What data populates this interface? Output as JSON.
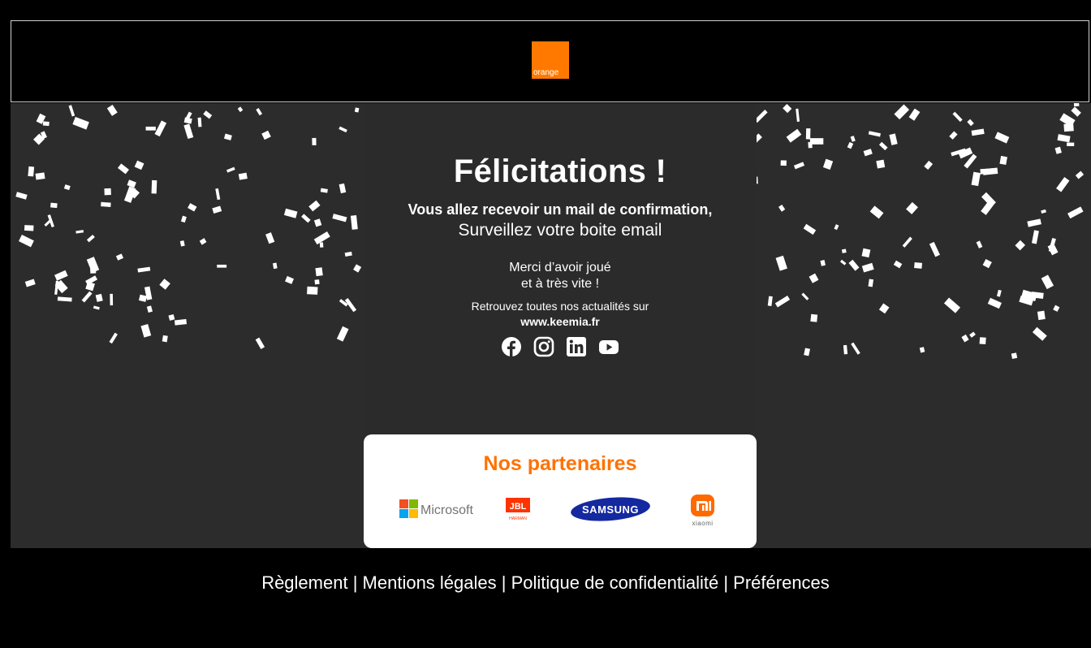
{
  "brand": {
    "logo_text": "orange",
    "color": "#ff7900"
  },
  "congrats": {
    "title": "Félicitations !",
    "mail_line": "Vous allez recevoir un mail de confirmation,",
    "watch_line": "Surveillez votre boite email",
    "thanks_line1": "Merci d’avoir joué",
    "thanks_line2": "et à très vite !",
    "news_line": "Retrouvez toutes nos actualités sur",
    "website": "www.keemia.fr"
  },
  "socials": [
    {
      "icon": "facebook-icon"
    },
    {
      "icon": "instagram-icon"
    },
    {
      "icon": "linkedin-icon"
    },
    {
      "icon": "youtube-icon"
    }
  ],
  "partners": {
    "title": "Nos partenaires",
    "title_color": "#ff7200",
    "logos": {
      "microsoft": "Microsoft",
      "jbl": "JBL",
      "harman": "HARMAN",
      "samsung": "SAMSUNG",
      "xiaomi": "xiaomi"
    }
  },
  "footer": {
    "links": [
      "Règlement",
      "Mentions légales",
      "Politique de confidentialité",
      "Préférences"
    ],
    "separator": " | "
  },
  "colors": {
    "background": "#000000",
    "stage": "#2c2c2c",
    "card": "#ffffff"
  }
}
